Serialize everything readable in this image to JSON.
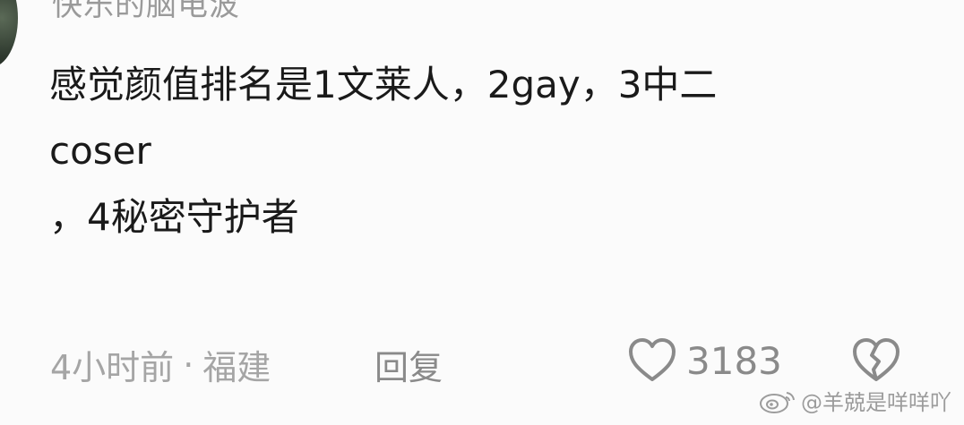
{
  "comment": {
    "username": "快乐的脑电波",
    "lines": [
      "感觉颜值排名是1文莱人，2gay，3中二",
      "coser",
      "，4秘密守护者"
    ],
    "time": "4小时前",
    "location": "福建",
    "separator": "·",
    "reply_label": "回复",
    "like_count": "3183"
  },
  "watermark": {
    "text": "@羊兢是咩咩吖",
    "icon": "weibo-icon"
  },
  "icons": {
    "like": "heart-outline-icon",
    "dislike": "broken-heart-icon"
  },
  "colors": {
    "text": "#1a1a1a",
    "meta": "#a5a5a5",
    "icon": "#8a8a8a"
  }
}
